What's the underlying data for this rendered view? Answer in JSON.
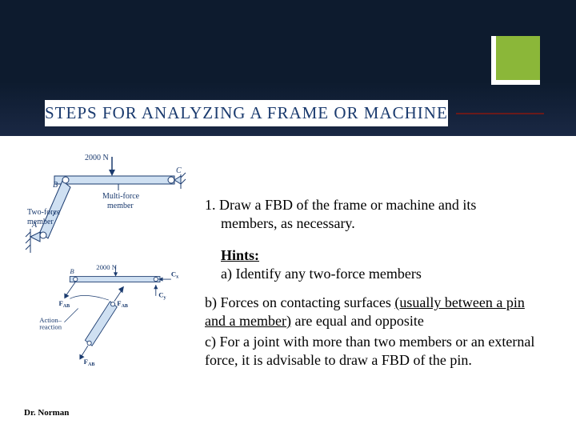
{
  "title": "STEPS  FOR  ANALYZING  A  FRAME  OR  MACHINE",
  "step1_lead": "1. Draw a FBD of the frame or machine and its",
  "step1_cont": "members, as necessary.",
  "hints_title": "Hints:",
  "hint_a": "a)  Identify any two-force members",
  "hint_b_pre": "b)  Forces on contacting surfaces ",
  "hint_b_u": "(usually between a pin and a member)",
  "hint_b_post": " are equal and opposite",
  "hint_c": "c)  For a joint with more than two members or an external force, it is advisable to draw a FBD of the pin.",
  "footer": "Dr. Norman",
  "fig1": {
    "load": "2000 N",
    "B": "B",
    "C": "C",
    "A": "A",
    "multi": "Multi-force",
    "member": "member",
    "two": "Two-force",
    "member2": "member"
  },
  "fig2": {
    "load": "2000 N",
    "B": "B",
    "FAB1": "F",
    "FAB1s": "AB",
    "FAB2": "F",
    "FAB2s": "AB",
    "Cx": "C",
    "Cxs": "x",
    "Cy": "C",
    "Cys": "y",
    "action": "Action–",
    "reaction": "reaction"
  }
}
